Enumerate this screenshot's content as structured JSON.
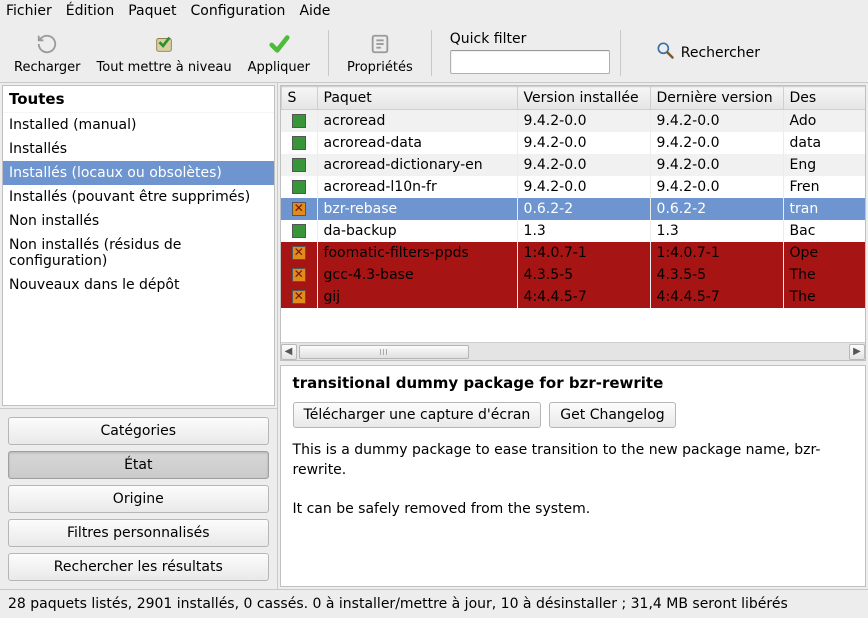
{
  "menu": {
    "file": "Fichier",
    "edit": "Édition",
    "package": "Paquet",
    "settings": "Configuration",
    "help": "Aide"
  },
  "toolbar": {
    "reload": "Recharger",
    "upgrade_all": "Tout mettre à niveau",
    "apply": "Appliquer",
    "properties": "Propriétés",
    "search": "Rechercher"
  },
  "quick_filter": {
    "label": "Quick filter",
    "value": ""
  },
  "categories": {
    "header": "Toutes",
    "items": [
      "Installed (manual)",
      "Installés",
      "Installés (locaux ou obsolètes)",
      "Installés (pouvant être supprimés)",
      "Non installés",
      "Non installés (résidus de configuration)",
      "Nouveaux dans le dépôt"
    ],
    "selected_index": 2
  },
  "left_buttons": {
    "categories": "Catégories",
    "state": "État",
    "origin": "Origine",
    "custom_filters": "Filtres personnalisés",
    "search_results": "Rechercher les résultats",
    "active": "state"
  },
  "table": {
    "columns": {
      "s": "S",
      "package": "Paquet",
      "installed_version": "Version installée",
      "latest_version": "Dernière version",
      "description": "Des"
    },
    "rows": [
      {
        "status": "installed",
        "name": "acroread",
        "iv": "9.4.2-0.0",
        "lv": "9.4.2-0.0",
        "desc": "Ado",
        "highlight": "none"
      },
      {
        "status": "installed",
        "name": "acroread-data",
        "iv": "9.4.2-0.0",
        "lv": "9.4.2-0.0",
        "desc": "data",
        "highlight": "none"
      },
      {
        "status": "installed",
        "name": "acroread-dictionary-en",
        "iv": "9.4.2-0.0",
        "lv": "9.4.2-0.0",
        "desc": "Eng",
        "highlight": "none"
      },
      {
        "status": "installed",
        "name": "acroread-l10n-fr",
        "iv": "9.4.2-0.0",
        "lv": "9.4.2-0.0",
        "desc": "Fren",
        "highlight": "none"
      },
      {
        "status": "marked-remove",
        "name": "bzr-rebase",
        "iv": "0.6.2-2",
        "lv": "0.6.2-2",
        "desc": "tran",
        "highlight": "selected"
      },
      {
        "status": "installed",
        "name": "da-backup",
        "iv": "1.3",
        "lv": "1.3",
        "desc": "Bac",
        "highlight": "none"
      },
      {
        "status": "marked-remove",
        "name": "foomatic-filters-ppds",
        "iv": "1:4.0.7-1",
        "lv": "1:4.0.7-1",
        "desc": "Ope",
        "highlight": "removed"
      },
      {
        "status": "marked-remove",
        "name": "gcc-4.3-base",
        "iv": "4.3.5-5",
        "lv": "4.3.5-5",
        "desc": "The",
        "highlight": "removed"
      },
      {
        "status": "marked-remove",
        "name": "gij",
        "iv": "4:4.4.5-7",
        "lv": "4:4.4.5-7",
        "desc": "The",
        "highlight": "removed"
      }
    ]
  },
  "details": {
    "title": "transitional dummy package for bzr-rewrite",
    "screenshot_btn": "Télécharger une capture d'écran",
    "changelog_btn": "Get Changelog",
    "para1": "This is a dummy package to ease transition to the new package name, bzr-rewrite.",
    "para2": "It can be safely removed from the system."
  },
  "statusbar": "28 paquets listés, 2901 installés, 0 cassés. 0 à installer/mettre à jour, 10 à désinstaller ; 31,4 MB seront libérés"
}
